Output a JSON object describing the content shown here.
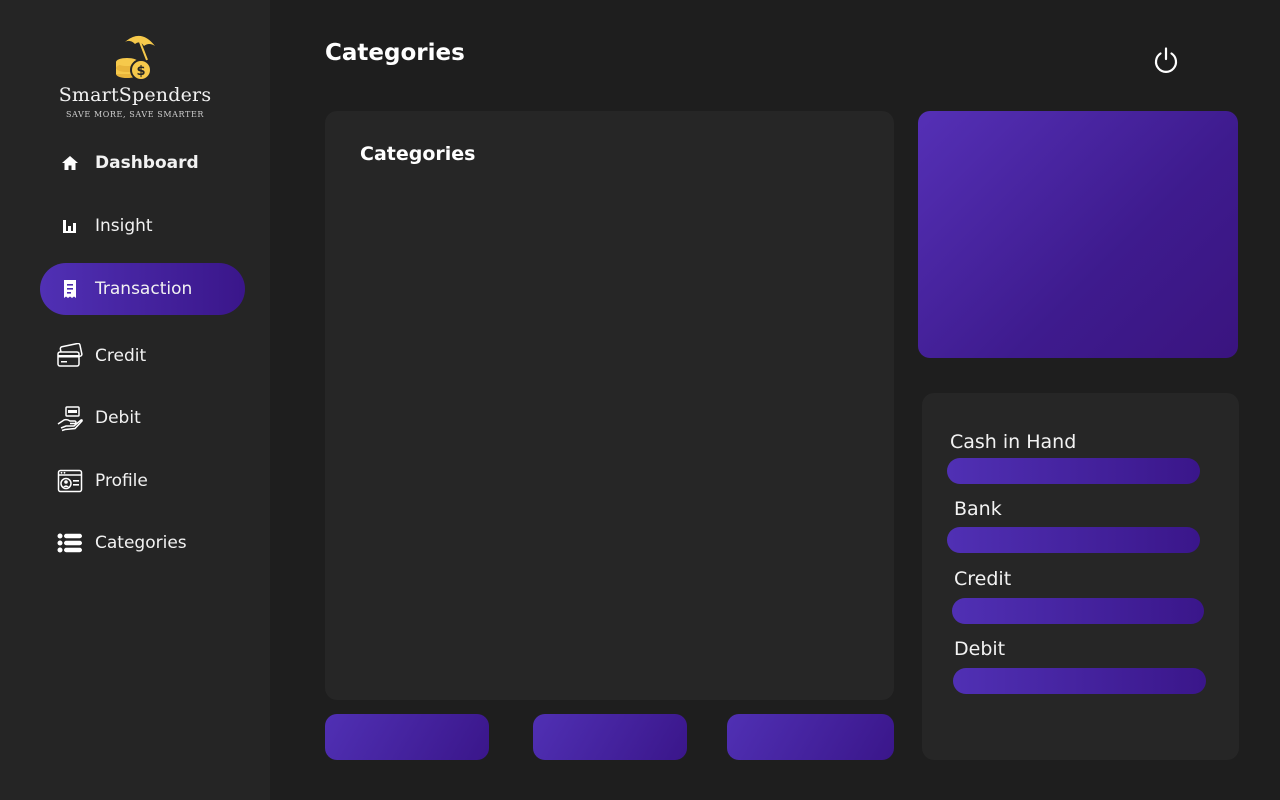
{
  "brand": {
    "name": "SmartSpenders",
    "tagline": "SAVE MORE, SAVE SMARTER",
    "logo_icon": "coin-umbrella-logo",
    "accent_color": "#f6c94b"
  },
  "sidebar": {
    "items": [
      {
        "label": "Dashboard",
        "icon": "home-icon"
      },
      {
        "label": "Insight",
        "icon": "bar-chart-icon"
      },
      {
        "label": "Transaction",
        "icon": "receipt-icon",
        "active": true
      },
      {
        "label": "Credit",
        "icon": "credit-card-icon"
      },
      {
        "label": "Debit",
        "icon": "hand-cash-icon"
      },
      {
        "label": "Profile",
        "icon": "id-card-icon"
      },
      {
        "label": "Categories",
        "icon": "list-icon"
      }
    ]
  },
  "header": {
    "title": "Categories",
    "power_icon": "power-icon"
  },
  "main": {
    "panel_title": "Categories"
  },
  "accounts": {
    "items": [
      {
        "label": "Cash in Hand"
      },
      {
        "label": "Bank"
      },
      {
        "label": "Credit"
      },
      {
        "label": "Debit"
      }
    ]
  },
  "colors": {
    "accent": "#4a2aae",
    "accent_dark": "#3a168a",
    "background": "#1e1e1e",
    "sidebar": "#252525",
    "panel": "#262626"
  }
}
